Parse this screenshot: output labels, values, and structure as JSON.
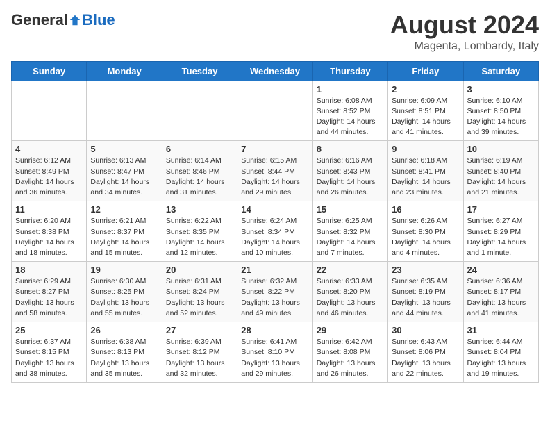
{
  "header": {
    "logo_general": "General",
    "logo_blue": "Blue",
    "month_year": "August 2024",
    "location": "Magenta, Lombardy, Italy"
  },
  "days_of_week": [
    "Sunday",
    "Monday",
    "Tuesday",
    "Wednesday",
    "Thursday",
    "Friday",
    "Saturday"
  ],
  "weeks": [
    [
      {
        "day": "",
        "info": ""
      },
      {
        "day": "",
        "info": ""
      },
      {
        "day": "",
        "info": ""
      },
      {
        "day": "",
        "info": ""
      },
      {
        "day": "1",
        "info": "Sunrise: 6:08 AM\nSunset: 8:52 PM\nDaylight: 14 hours\nand 44 minutes."
      },
      {
        "day": "2",
        "info": "Sunrise: 6:09 AM\nSunset: 8:51 PM\nDaylight: 14 hours\nand 41 minutes."
      },
      {
        "day": "3",
        "info": "Sunrise: 6:10 AM\nSunset: 8:50 PM\nDaylight: 14 hours\nand 39 minutes."
      }
    ],
    [
      {
        "day": "4",
        "info": "Sunrise: 6:12 AM\nSunset: 8:49 PM\nDaylight: 14 hours\nand 36 minutes."
      },
      {
        "day": "5",
        "info": "Sunrise: 6:13 AM\nSunset: 8:47 PM\nDaylight: 14 hours\nand 34 minutes."
      },
      {
        "day": "6",
        "info": "Sunrise: 6:14 AM\nSunset: 8:46 PM\nDaylight: 14 hours\nand 31 minutes."
      },
      {
        "day": "7",
        "info": "Sunrise: 6:15 AM\nSunset: 8:44 PM\nDaylight: 14 hours\nand 29 minutes."
      },
      {
        "day": "8",
        "info": "Sunrise: 6:16 AM\nSunset: 8:43 PM\nDaylight: 14 hours\nand 26 minutes."
      },
      {
        "day": "9",
        "info": "Sunrise: 6:18 AM\nSunset: 8:41 PM\nDaylight: 14 hours\nand 23 minutes."
      },
      {
        "day": "10",
        "info": "Sunrise: 6:19 AM\nSunset: 8:40 PM\nDaylight: 14 hours\nand 21 minutes."
      }
    ],
    [
      {
        "day": "11",
        "info": "Sunrise: 6:20 AM\nSunset: 8:38 PM\nDaylight: 14 hours\nand 18 minutes."
      },
      {
        "day": "12",
        "info": "Sunrise: 6:21 AM\nSunset: 8:37 PM\nDaylight: 14 hours\nand 15 minutes."
      },
      {
        "day": "13",
        "info": "Sunrise: 6:22 AM\nSunset: 8:35 PM\nDaylight: 14 hours\nand 12 minutes."
      },
      {
        "day": "14",
        "info": "Sunrise: 6:24 AM\nSunset: 8:34 PM\nDaylight: 14 hours\nand 10 minutes."
      },
      {
        "day": "15",
        "info": "Sunrise: 6:25 AM\nSunset: 8:32 PM\nDaylight: 14 hours\nand 7 minutes."
      },
      {
        "day": "16",
        "info": "Sunrise: 6:26 AM\nSunset: 8:30 PM\nDaylight: 14 hours\nand 4 minutes."
      },
      {
        "day": "17",
        "info": "Sunrise: 6:27 AM\nSunset: 8:29 PM\nDaylight: 14 hours\nand 1 minute."
      }
    ],
    [
      {
        "day": "18",
        "info": "Sunrise: 6:29 AM\nSunset: 8:27 PM\nDaylight: 13 hours\nand 58 minutes."
      },
      {
        "day": "19",
        "info": "Sunrise: 6:30 AM\nSunset: 8:25 PM\nDaylight: 13 hours\nand 55 minutes."
      },
      {
        "day": "20",
        "info": "Sunrise: 6:31 AM\nSunset: 8:24 PM\nDaylight: 13 hours\nand 52 minutes."
      },
      {
        "day": "21",
        "info": "Sunrise: 6:32 AM\nSunset: 8:22 PM\nDaylight: 13 hours\nand 49 minutes."
      },
      {
        "day": "22",
        "info": "Sunrise: 6:33 AM\nSunset: 8:20 PM\nDaylight: 13 hours\nand 46 minutes."
      },
      {
        "day": "23",
        "info": "Sunrise: 6:35 AM\nSunset: 8:19 PM\nDaylight: 13 hours\nand 44 minutes."
      },
      {
        "day": "24",
        "info": "Sunrise: 6:36 AM\nSunset: 8:17 PM\nDaylight: 13 hours\nand 41 minutes."
      }
    ],
    [
      {
        "day": "25",
        "info": "Sunrise: 6:37 AM\nSunset: 8:15 PM\nDaylight: 13 hours\nand 38 minutes."
      },
      {
        "day": "26",
        "info": "Sunrise: 6:38 AM\nSunset: 8:13 PM\nDaylight: 13 hours\nand 35 minutes."
      },
      {
        "day": "27",
        "info": "Sunrise: 6:39 AM\nSunset: 8:12 PM\nDaylight: 13 hours\nand 32 minutes."
      },
      {
        "day": "28",
        "info": "Sunrise: 6:41 AM\nSunset: 8:10 PM\nDaylight: 13 hours\nand 29 minutes."
      },
      {
        "day": "29",
        "info": "Sunrise: 6:42 AM\nSunset: 8:08 PM\nDaylight: 13 hours\nand 26 minutes."
      },
      {
        "day": "30",
        "info": "Sunrise: 6:43 AM\nSunset: 8:06 PM\nDaylight: 13 hours\nand 22 minutes."
      },
      {
        "day": "31",
        "info": "Sunrise: 6:44 AM\nSunset: 8:04 PM\nDaylight: 13 hours\nand 19 minutes."
      }
    ]
  ]
}
